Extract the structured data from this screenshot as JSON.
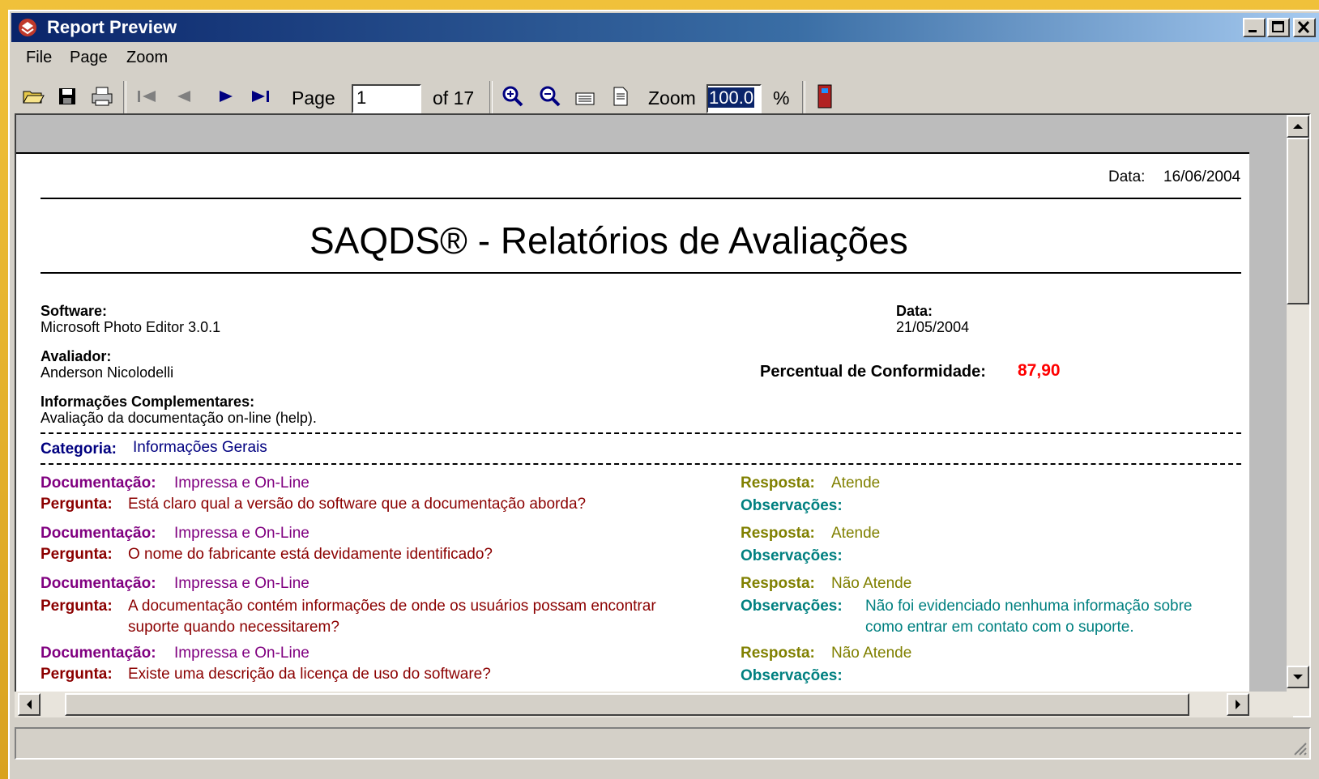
{
  "window": {
    "title": "Report Preview"
  },
  "menu": {
    "items": [
      "File",
      "Page",
      "Zoom"
    ]
  },
  "toolbar": {
    "page_label": "Page",
    "page_value": "1",
    "of_label": "of 17",
    "zoom_label": "Zoom",
    "zoom_value": "100.0",
    "percent": "%"
  },
  "report": {
    "print_date_label": "Data:",
    "print_date": "16/06/2004",
    "title": "SAQDS® - Relatórios de Avaliações",
    "software_label": "Software:",
    "software": "Microsoft Photo Editor 3.0.1",
    "date_label": "Data:",
    "date": "21/05/2004",
    "evaluator_label": "Avaliador:",
    "evaluator": "Anderson Nicolodelli",
    "conformity_label": "Percentual de Conformidade:",
    "conformity": "87,90",
    "info_label": "Informações Complementares:",
    "info": "Avaliação da documentação on-line (help).",
    "category_label": "Categoria:",
    "category": "Informações Gerais",
    "entries": [
      {
        "doc_label": "Documentação:",
        "doc": "Impressa e On-Line",
        "question_label": "Pergunta:",
        "question_1": "Está claro qual a versão do software que a documentação aborda?",
        "question_2": "",
        "answer_label": "Resposta:",
        "answer": "Atende",
        "obs_label": "Observações:",
        "obs_1": "",
        "obs_2": ""
      },
      {
        "doc_label": "Documentação:",
        "doc": "Impressa e On-Line",
        "question_label": "Pergunta:",
        "question_1": "O nome do fabricante está devidamente identificado?",
        "question_2": "",
        "answer_label": "Resposta:",
        "answer": "Atende",
        "obs_label": "Observações:",
        "obs_1": "",
        "obs_2": ""
      },
      {
        "doc_label": "Documentação:",
        "doc": "Impressa e On-Line",
        "question_label": "Pergunta:",
        "question_1": "A documentação contém informações de onde os usuários possam encontrar",
        "question_2": "suporte quando necessitarem?",
        "answer_label": "Resposta:",
        "answer": "Não Atende",
        "obs_label": "Observações:",
        "obs_1": "Não foi evidenciado nenhuma informação sobre",
        "obs_2": "como entrar em contato com o suporte."
      },
      {
        "doc_label": "Documentação:",
        "doc": "Impressa e On-Line",
        "question_label": "Pergunta:",
        "question_1": "Existe uma descrição da licença de uso do software?",
        "question_2": "",
        "answer_label": "Resposta:",
        "answer": "Não Atende",
        "obs_label": "Observações:",
        "obs_1": "",
        "obs_2": ""
      }
    ]
  },
  "colors": {
    "title_bar": "#0a246a",
    "conformity": "#ff0000",
    "doc": "#800080",
    "question": "#8b0000",
    "answer": "#808000",
    "obs": "#008080",
    "category": "#000080"
  }
}
